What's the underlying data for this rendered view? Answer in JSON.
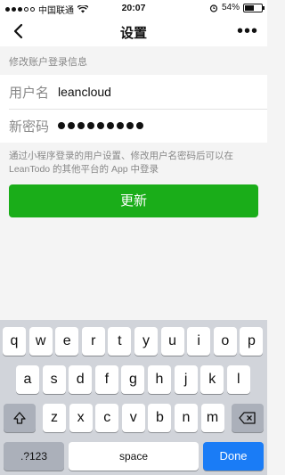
{
  "status": {
    "carrier": "中国联通",
    "time": "20:07",
    "battery": "54%",
    "battery_level": 0.54
  },
  "nav": {
    "title": "设置",
    "more": "•••"
  },
  "section": {
    "title": "修改账户登录信息"
  },
  "form": {
    "username_label": "用户名",
    "username_value": "leancloud",
    "password_label": "新密码",
    "password_dots": 9
  },
  "note": "通过小程序登录的用户设置、修改用户名密码后可以在 LeanTodo 的其他平台的 App 中登录",
  "button": {
    "label": "更新"
  },
  "keyboard": {
    "row1": [
      "q",
      "w",
      "e",
      "r",
      "t",
      "y",
      "u",
      "i",
      "o",
      "p"
    ],
    "row2": [
      "a",
      "s",
      "d",
      "f",
      "g",
      "h",
      "j",
      "k",
      "l"
    ],
    "row3": [
      "z",
      "x",
      "c",
      "v",
      "b",
      "n",
      "m"
    ],
    "shift_icon": "shift-icon",
    "delete_icon": "delete-icon",
    "numbers": ".?123",
    "space": "space",
    "done": "Done"
  }
}
